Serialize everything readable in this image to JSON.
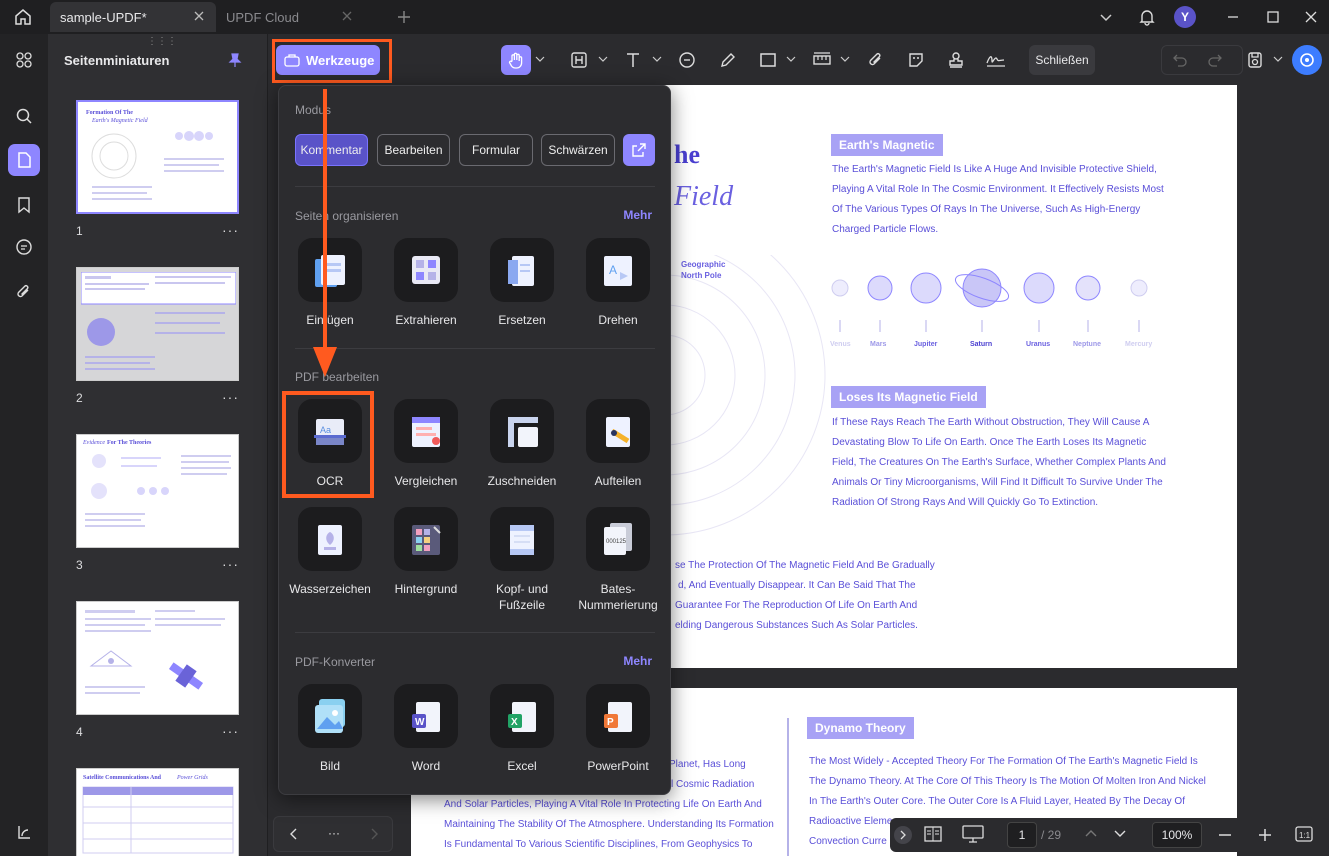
{
  "tabs": [
    {
      "label": "sample-UPDF*"
    },
    {
      "label": "UPDF Cloud"
    }
  ],
  "user": {
    "initial": "Y"
  },
  "sidebar": {
    "title": "Seitenminiaturen"
  },
  "thumbnails": [
    {
      "num": "1"
    },
    {
      "num": "2"
    },
    {
      "num": "3"
    },
    {
      "num": "4"
    }
  ],
  "thumb_titles": {
    "t1a": "Formation Of The",
    "t1b": "Earth's Magnetic Field",
    "t3a": "Evidence",
    "t3b": "For The Theories",
    "t5a": "Satellite Communications And",
    "t5b": "Power Grids"
  },
  "toolbar": {
    "werkzeuge": "Werkzeuge",
    "close": "Schließen"
  },
  "tools_popup": {
    "modes_label": "Modus",
    "modes": [
      "Kommentar",
      "Bearbeiten",
      "Formular",
      "Schwärzen"
    ],
    "organize_label": "Seiten organisieren",
    "organize_more": "Mehr",
    "organize": [
      "Einfügen",
      "Extrahieren",
      "Ersetzen",
      "Drehen"
    ],
    "edit_label": "PDF bearbeiten",
    "edit": [
      "OCR",
      "Vergleichen",
      "Zuschneiden",
      "Aufteilen",
      "Wasserzeichen",
      "Hintergrund",
      "Kopf- und Fußzeile",
      "Bates-Nummerierung"
    ],
    "convert_label": "PDF-Konverter",
    "convert_more": "Mehr",
    "convert": [
      "Bild",
      "Word",
      "Excel",
      "PowerPoint"
    ]
  },
  "page1": {
    "title_a": "he",
    "title_b": "Field",
    "h1": "Earth's Magnetic",
    "p1": [
      "The Earth's Magnetic Field Is Like A Huge And Invisible Protective Shield,",
      "Playing A Vital Role In The Cosmic Environment. It Effectively Resists Most",
      "Of The Various Types Of Rays In The Universe, Such As High-Energy",
      "Charged Particle Flows."
    ],
    "pole": [
      "Geographic",
      "North Pole"
    ],
    "planets": [
      "Venus",
      "Mars",
      "Jupiter",
      "Saturn",
      "Uranus",
      "Neptune",
      "Mercury"
    ],
    "h2": "Loses Its Magnetic Field",
    "p2": [
      "If These Rays Reach The Earth Without Obstruction, They Will Cause A",
      "Devastating Blow To Life On Earth. Once The Earth Loses Its Magnetic",
      "Field, The Creatures On The Earth's Surface, Whether Complex Plants And",
      "Animals Or Tiny Microorganisms, Will Find It Difficult To Survive Under The",
      "Radiation Of Strong Rays And Will Quickly Go To Extinction."
    ],
    "p3": [
      "se The Protection Of The Magnetic Field And Be Gradually",
      "d, And Eventually Disappear. It Can Be Said That The",
      "Guarantee For The Reproduction Of Life On Earth And",
      "elding Dangerous Substances Such As Solar Particles."
    ]
  },
  "page2": {
    "left": [
      "Planet, Has Long",
      "l Cosmic Radiation",
      "And Solar Particles, Playing A Vital Role In Protecting Life On Earth And",
      "Maintaining The Stability Of The Atmosphere. Understanding Its Formation",
      "Is Fundamental To Various Scientific Disciplines, From Geophysics To"
    ],
    "h": "Dynamo Theory",
    "right": [
      "The Most Widely - Accepted Theory For The Formation Of The Earth's Magnetic Field Is",
      "The Dynamo Theory. At The Core Of This Theory Is The Motion Of Molten Iron And Nickel",
      "In The Earth's Outer Core. The Outer Core Is A Fluid Layer, Heated By The Decay Of",
      "Radioactive Eleme",
      "Convection Curre"
    ]
  },
  "pager": {
    "current": "1",
    "total": "/ 29",
    "zoom": "100%"
  },
  "colors": {
    "accent": "#8e86ff",
    "highlight": "#ff5a1f"
  }
}
